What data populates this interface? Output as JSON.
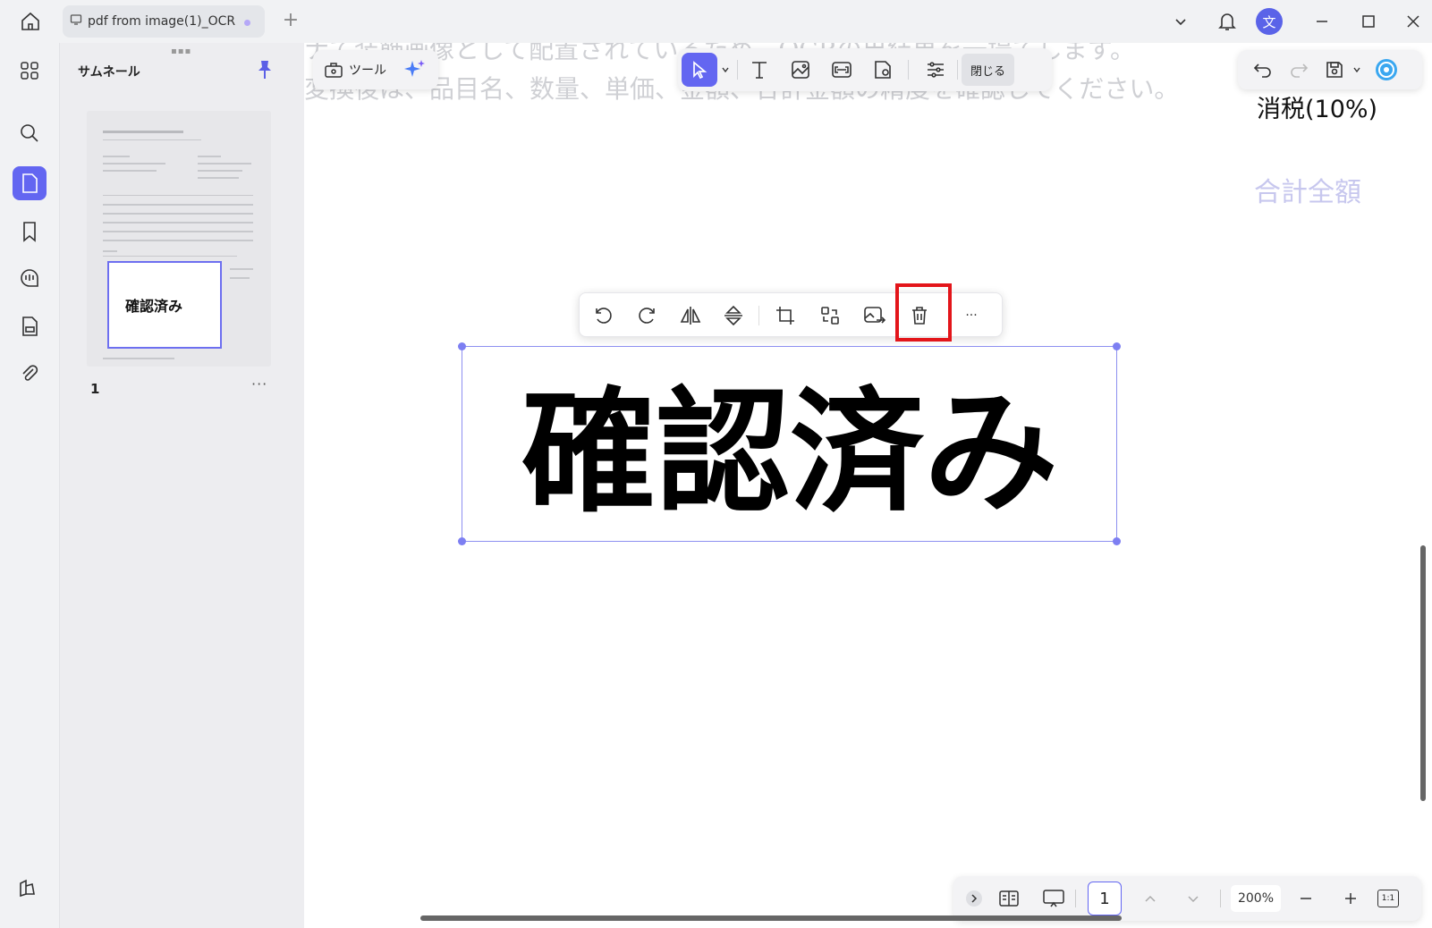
{
  "tab": {
    "title": "pdf from image(1)_OCR",
    "add": "+"
  },
  "user": {
    "avatar_initial": "文"
  },
  "thumbnail_panel": {
    "title": "サムネール",
    "page_number": "1",
    "more": "···"
  },
  "toolbar": {
    "tool_label": "ツール",
    "close_label": "閉じる"
  },
  "document": {
    "bg_line1": "ナて装飾画像として配置されているため、OCRの出結果を一場てします。",
    "bg_line2": "変換後は、品目名、数量、単価、金額、合計金額の精度を確認してください。",
    "tax_label": "消税(10%)",
    "total_label": "合計全額",
    "stamp_text": "確認済み"
  },
  "image_toolbar": {
    "more": "···"
  },
  "bottom_bar": {
    "page": "1",
    "zoom": "200%",
    "fit_label": "1:1"
  },
  "colors": {
    "accent": "#6366f1",
    "highlight": "#e3151a"
  }
}
